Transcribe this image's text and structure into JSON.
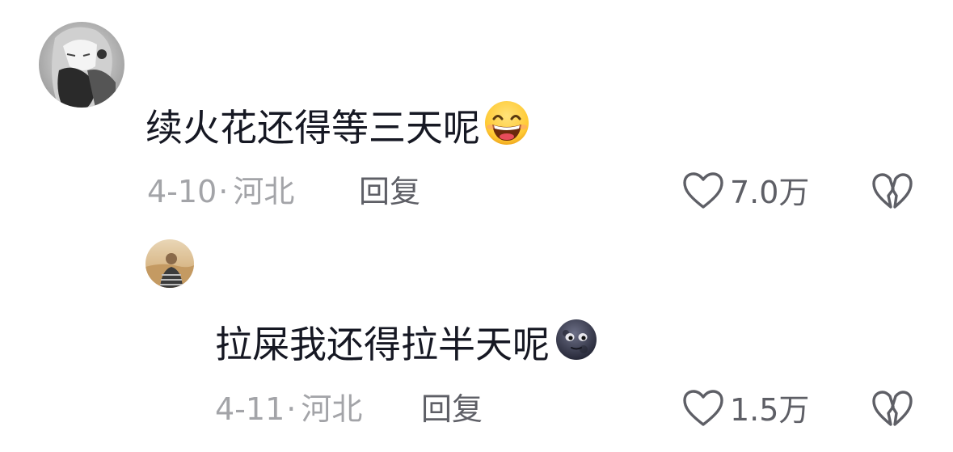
{
  "comments": [
    {
      "text": "续火花还得等三天呢",
      "emoji": "grinning-squinting-face",
      "date": "4-10",
      "separator": "·",
      "location": "河北",
      "reply_label": "回复",
      "likes": "7.0万",
      "avatar": "anime-manga-girl-grayscale"
    },
    {
      "text": "拉屎我还得拉半天呢",
      "emoji": "new-moon-face",
      "date": "4-11",
      "separator": "·",
      "location": "河北",
      "reply_label": "回复",
      "likes": "1.5万",
      "avatar": "person-in-desert-photo"
    }
  ],
  "icons": {
    "like": "heart-outline-icon",
    "dislike": "broken-heart-icon"
  },
  "colors": {
    "text_primary": "#161823",
    "text_meta": "#a3a4a8",
    "text_action": "#5e5f66",
    "icon": "#5e5f66"
  }
}
